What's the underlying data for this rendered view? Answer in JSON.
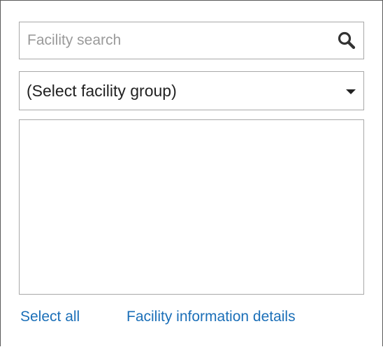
{
  "search": {
    "placeholder": "Facility search",
    "value": "",
    "icon": "search-icon"
  },
  "facility_group": {
    "selected": "(Select facility group)",
    "icon": "chevron-down-icon"
  },
  "facility_list": {
    "items": []
  },
  "links": {
    "select_all": "Select all",
    "details": "Facility information details"
  },
  "colors": {
    "link": "#1b6fb8",
    "border": "#a8a8a8",
    "placeholder": "#9a9a9a"
  }
}
